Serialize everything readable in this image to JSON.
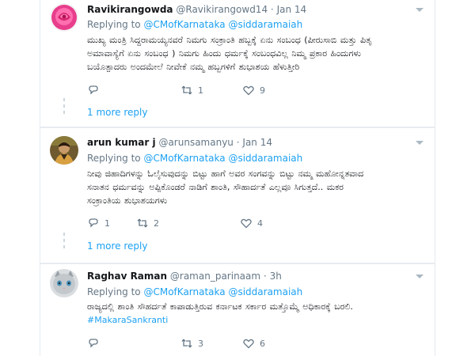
{
  "tweets": [
    {
      "name": "Ravikirangowda",
      "handle": "@Ravikirangowd14",
      "time": "Jan 14",
      "replying_prefix": "Replying to",
      "mention_1": "@CMofKarnataka",
      "mention_2": "@siddaramaiah",
      "line_1": "ಮುಖ್ಯ ಮಂತ್ರಿ ಸಿದ್ದರಾಮಯ್ಯನವರೆ ನಿಮಗು ಸಂಕ್ರಾಂತಿ ಹಬ್ಬಕ್ಕೆ ಏನು ಸಂಬಂಧ (ಪೀರುಸಾಬಿ ಮತ್ತು ಪಿತೃ",
      "line_2": "ಅಮಾವಾಸ್ಯೆಗೆ ಏನು ಸಂಬಂಧ ) ನಿಮಗು ಹಿಂದು ಧರ್ಮಕ್ಕೆ ಸಂಬಂಧವಿಲ್ಲ ನಿಮ್ಮ ಪ್ರಕಾರ ಹಿಂದುಗಳು",
      "line_3": "ಬಯೊತ್ಪಾದರು ಅಂದಮೇಲೆ ನೀವೇಕೆ ನಮ್ಮ ಹಬ್ಬಗಳಿಗೆ ಶುಭಾಶಯ ಹೆಳುತ್ತೀರಿ",
      "replies": "",
      "retweets": "1",
      "likes": "9",
      "more_reply": "1 more reply"
    },
    {
      "name": "arun kumar j",
      "handle": "@arunsamanyu",
      "time": "Jan 14",
      "replying_prefix": "Replying to",
      "mention_1": "@CMofKarnataka",
      "mention_2": "@siddaramaiah",
      "line_1": "ನೀವು ಜಿಹಾದಿಗಳನ್ನು ಓಲೈಸುವುದನ್ನು ಬಿಟ್ಟು ಹಾಗೆ ಅವರ ಸಂಗವನ್ನು ಬಿಟ್ಟು ನಮ್ಮ ಮಹೋನ್ನತವಾದ",
      "line_2": "ಸನಾತನ ಧರ್ಮವನ್ನು ಅಪ್ಪಿಕೊಂಡರೆ ನಾಡಿಗೆ ಶಾಂತಿ, ಸೌಹಾರ್ದತೆ ಎಲ್ಲವೂ ಸಿಗುತ್ತದೆ.. ಮಕರ",
      "line_3": "ಸಂಕ್ರಾಂತಿಯ ಶುಭಾಶಯಗಳು",
      "replies": "1",
      "retweets": "2",
      "likes": "4",
      "more_reply": "1 more reply"
    },
    {
      "name": "Raghav Raman",
      "handle": "@raman_parinaam",
      "time": "3h",
      "replying_prefix": "Replying to",
      "mention_1": "@CMofKarnataka",
      "mention_2": "@siddaramaiah",
      "line_1": "ರಾಜ್ಯದಲ್ಲಿ ಶಾಂತಿ ಸೌಹರ್ದತೆ ಕಾಪಾಡುತ್ತಿರುವ ಕರ್ನಾಟಕ ಸರ್ಕಾರ ಮತ್ತೊಮ್ಮೆ ಅಧಿಕಾರಕ್ಕೆ ಬರಲಿ.",
      "hashtag": "#MakaraSankranti",
      "replies": "",
      "retweets": "3",
      "likes": "6"
    }
  ],
  "colors": {
    "link": "#1da1f2",
    "text": "#14171a",
    "muted": "#657786",
    "border": "#e6ecf0"
  },
  "icons": [
    "reply-icon",
    "retweet-icon",
    "like-icon",
    "caret-down-icon"
  ]
}
